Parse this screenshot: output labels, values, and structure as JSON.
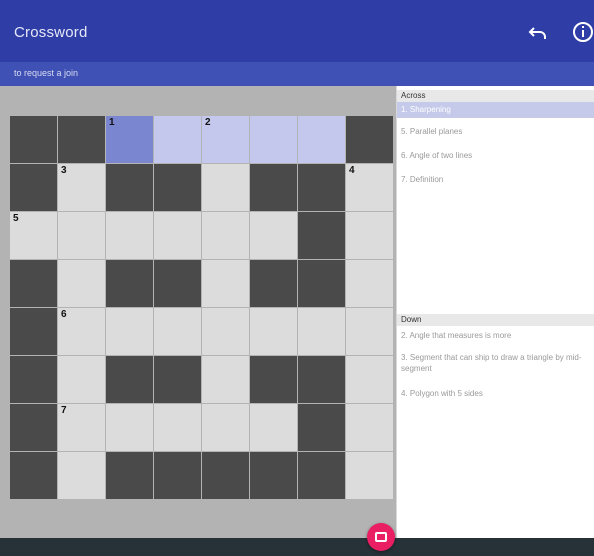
{
  "app": {
    "title": "Crossword"
  },
  "subtitle": "to request a join",
  "icons": {
    "undo": "undo-icon",
    "info": "info-icon"
  },
  "colors": {
    "appbar": "#2f3ea6",
    "subbar": "#3f51b5",
    "active_cell": "#7a86d0",
    "highlight_cell": "#c3c8ec",
    "fab": "#e91e63"
  },
  "grid": {
    "rows": 8,
    "cols": 8,
    "cells": [
      [
        "B",
        "B",
        "A",
        "H",
        "H",
        "H",
        "H",
        "B"
      ],
      [
        "B",
        "O",
        "B",
        "B",
        "O",
        "B",
        "B",
        "O"
      ],
      [
        "O",
        "O",
        "O",
        "O",
        "O",
        "O",
        "B",
        "O"
      ],
      [
        "B",
        "O",
        "B",
        "B",
        "O",
        "B",
        "B",
        "O"
      ],
      [
        "B",
        "O",
        "O",
        "O",
        "O",
        "O",
        "O",
        "O"
      ],
      [
        "B",
        "O",
        "B",
        "B",
        "O",
        "B",
        "B",
        "O"
      ],
      [
        "B",
        "O",
        "O",
        "O",
        "O",
        "O",
        "B",
        "O"
      ],
      [
        "B",
        "O",
        "B",
        "B",
        "B",
        "B",
        "B",
        "O"
      ]
    ],
    "numbers": [
      {
        "row": 0,
        "col": 2,
        "n": "1"
      },
      {
        "row": 0,
        "col": 4,
        "n": "2"
      },
      {
        "row": 1,
        "col": 1,
        "n": "3"
      },
      {
        "row": 1,
        "col": 7,
        "n": "4"
      },
      {
        "row": 2,
        "col": 0,
        "n": "5"
      },
      {
        "row": 4,
        "col": 1,
        "n": "6"
      },
      {
        "row": 6,
        "col": 1,
        "n": "7"
      }
    ]
  },
  "clues": {
    "across_label": "Across",
    "down_label": "Down",
    "across": [
      "1. Sharpening",
      "5. Parallel planes",
      "6. Angle of two lines",
      "7. Definition"
    ],
    "down": [
      "2. Angle that measures is more",
      "3. Segment that can ship to draw a triangle by mid-segment",
      "4. Polygon with 5 sides"
    ]
  }
}
